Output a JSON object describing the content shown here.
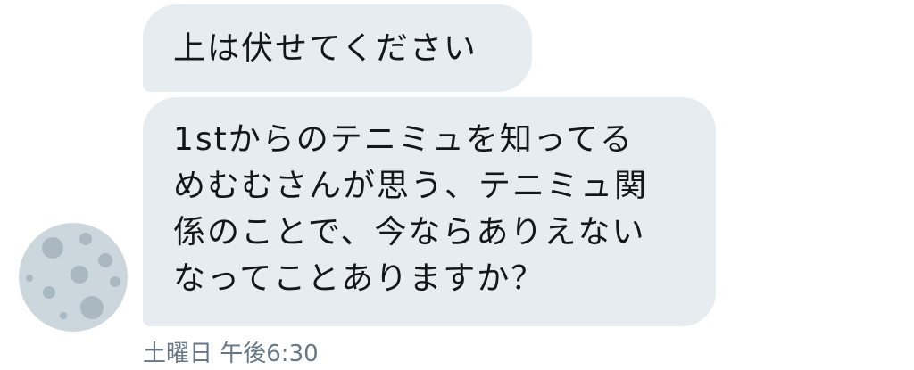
{
  "conversation": {
    "messages": [
      {
        "text": "上は伏せてください"
      },
      {
        "lines": [
          "1stからのテニミュを知ってる",
          "めむむさんが思う、テニミュ関",
          "係のことで、今ならありえない",
          "なってことありますか？"
        ]
      }
    ],
    "timestamp": "土曜日 午後6:30",
    "avatar_icon": "moon-icon"
  },
  "colors": {
    "bubble_background": "#e6ecf0",
    "bubble_text": "#14171a",
    "timestamp_text": "#657786",
    "avatar_base": "#ccd6dd",
    "avatar_craters": "#aab8c2"
  }
}
